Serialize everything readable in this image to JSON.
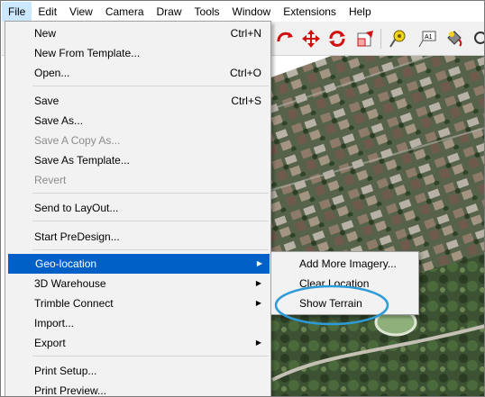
{
  "menubar": {
    "items": [
      "File",
      "Edit",
      "View",
      "Camera",
      "Draw",
      "Tools",
      "Window",
      "Extensions",
      "Help"
    ]
  },
  "file_menu": {
    "items": [
      {
        "label": "New",
        "shortcut": "Ctrl+N"
      },
      {
        "label": "New From Template..."
      },
      {
        "label": "Open...",
        "shortcut": "Ctrl+O"
      },
      {
        "label": "Save",
        "shortcut": "Ctrl+S"
      },
      {
        "label": "Save As..."
      },
      {
        "label": "Save A Copy As...",
        "disabled": true
      },
      {
        "label": "Save As Template..."
      },
      {
        "label": "Revert",
        "disabled": true
      },
      {
        "label": "Send to LayOut..."
      },
      {
        "label": "Start PreDesign..."
      },
      {
        "label": "Geo-location",
        "submenu": true,
        "highlighted": true
      },
      {
        "label": "3D Warehouse",
        "submenu": true
      },
      {
        "label": "Trimble Connect",
        "submenu": true
      },
      {
        "label": "Import..."
      },
      {
        "label": "Export",
        "submenu": true
      },
      {
        "label": "Print Setup..."
      },
      {
        "label": "Print Preview..."
      }
    ]
  },
  "geo_submenu": {
    "items": [
      "Add More Imagery...",
      "Clear Location",
      "Show Terrain"
    ]
  },
  "toolbar": {
    "icons": [
      "orbit-icon",
      "pan-icon",
      "rotate-icon",
      "scale-icon",
      "tape-measure-icon",
      "text-icon",
      "paint-bucket-icon",
      "search-icon"
    ]
  },
  "colors": {
    "highlight": "#0060c7",
    "callout": "#2e9bd8"
  }
}
